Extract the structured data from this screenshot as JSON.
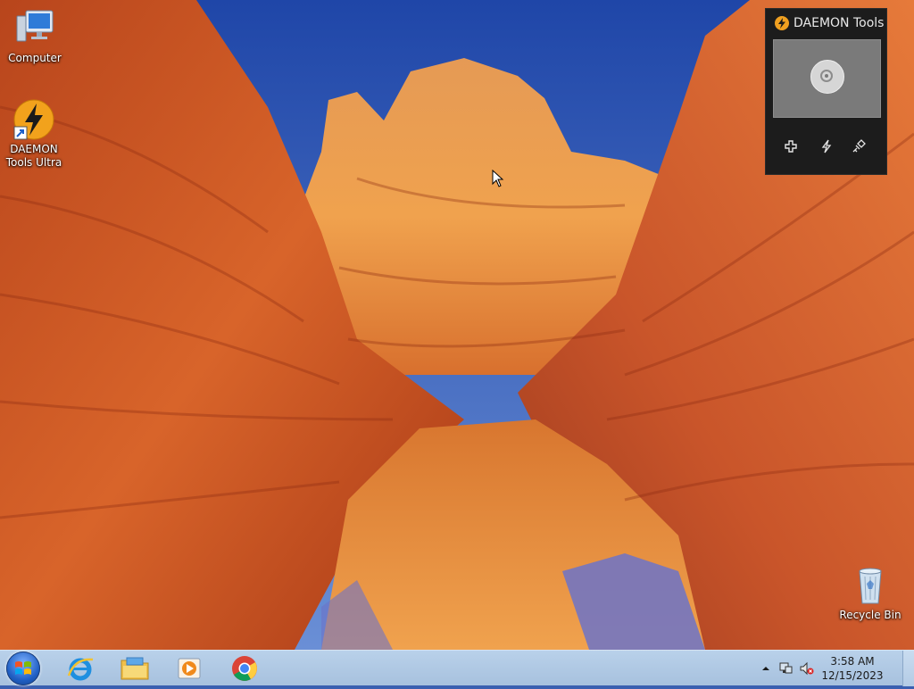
{
  "desktop": {
    "icons": [
      {
        "label": "Computer",
        "icon": "computer-icon"
      },
      {
        "label": "DAEMON\nTools Ultra",
        "icon": "daemon-tools-icon"
      },
      {
        "label": "Recycle Bin",
        "icon": "recycle-bin-icon"
      }
    ]
  },
  "gadget": {
    "title": "DAEMON Tools",
    "drive_icon": "disc-icon",
    "actions": [
      "add-icon",
      "quick-mount-icon",
      "unmount-icon"
    ]
  },
  "taskbar": {
    "start_icon": "windows-start-icon",
    "pinned": [
      "internet-explorer-icon",
      "file-explorer-icon",
      "media-player-icon",
      "chrome-icon"
    ],
    "tray": {
      "icons": [
        "show-hidden-icons-icon",
        "network-icon",
        "volume-muted-icon"
      ],
      "time": "3:58 AM",
      "date": "12/15/2023"
    }
  },
  "colors": {
    "taskbar": "#b9d1ea",
    "gadget_bg": "#1c1c1c",
    "daemon_orange": "#f0a020"
  }
}
